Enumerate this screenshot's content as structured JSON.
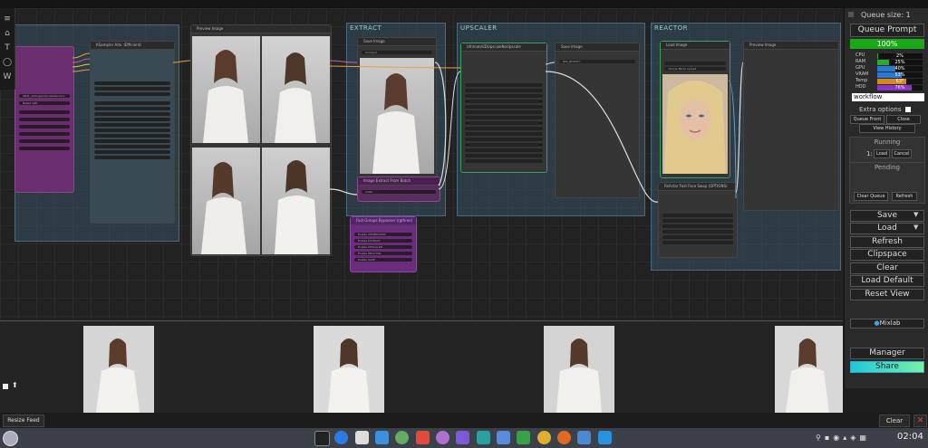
{
  "app": {
    "title": "ComfyUI"
  },
  "toolbar": {
    "tools": [
      "menu-icon",
      "home-icon",
      "text-icon",
      "circle-icon",
      "w-icon"
    ],
    "labels": [
      "≡",
      "⌂",
      "T",
      "◯",
      "W"
    ]
  },
  "groups": {
    "extract": "EXTRACT",
    "upscaler": "UPSCALER",
    "reactor": "REACTOR"
  },
  "nodes": {
    "preview_image": "Preview Image",
    "ksampler": "KSampler Adv. (Efficient)",
    "save_image": "Save Image",
    "upscale": "UltimateSDUpscaleNoUpscale",
    "image_extract": "Image Extract From Batch",
    "fast_groups": "Fast Groups Bypasser (rgthree)",
    "input_image": "Load Image",
    "reactor_node": "ReActor Fast Face Swap (OPTIONS)",
    "model_name": "SDXL_xl\\OrigamiAI.safetensors",
    "vae": "Baked VAE",
    "filename_prefix": "ComfyUI",
    "filename_prefix2": "IMG_BOOSTY",
    "choose_file": "choose file to upload",
    "index": "index",
    "toggles": [
      "Enable GENERATION",
      "Enable EXTRACT",
      "Enable UPSCALER",
      "Enable REACTOR",
      "Enable SAVE"
    ]
  },
  "panel": {
    "queue_size": "Queue size: 1",
    "queue_prompt": "Queue Prompt",
    "progress": "100%",
    "progress_value": 1.0,
    "stats": [
      {
        "label": "CPU",
        "value": "2%",
        "fraction": 0.02,
        "color": "#2ea82e"
      },
      {
        "label": "RAM",
        "value": "25%",
        "fraction": 0.25,
        "color": "#2ea82e"
      },
      {
        "label": "GPU",
        "value": "40%",
        "fraction": 0.4,
        "color": "#2a77d6"
      },
      {
        "label": "VRAM",
        "value": "53%",
        "fraction": 0.53,
        "color": "#2a77d6"
      },
      {
        "label": "Temp",
        "value": "63°",
        "fraction": 0.63,
        "color": "#d68a1e"
      },
      {
        "label": "HDD",
        "value": "76%",
        "fraction": 0.76,
        "color": "#8a35c7"
      }
    ],
    "workflow_value": "workflow",
    "extra_options": "Extra options",
    "queue_front": "Queue Front",
    "close": "Close",
    "view_history": "View History",
    "running": "Running",
    "running_item": "1:",
    "load": "Load",
    "cancel": "Cancel",
    "pending": "Pending",
    "clear_queue": "Clear Queue",
    "refresh_small": "Refresh",
    "save": "Save",
    "load_btn": "Load",
    "refresh": "Refresh",
    "clipspace": "Clipspace",
    "clear": "Clear",
    "load_default": "Load Default",
    "reset_view": "Reset View",
    "mixlab": "Mixlab",
    "manager": "Manager",
    "share": "Share"
  },
  "feed": {
    "resize_feed": "Resize Feed",
    "clear": "Clear"
  },
  "taskbar": {
    "clock": "02:04",
    "apps": [
      "terminal",
      "browser-blue",
      "files",
      "folder",
      "chrome-like",
      "photo",
      "app",
      "vscode",
      "book",
      "grid",
      "play",
      "chrome",
      "firefox",
      "window",
      "docker"
    ]
  }
}
